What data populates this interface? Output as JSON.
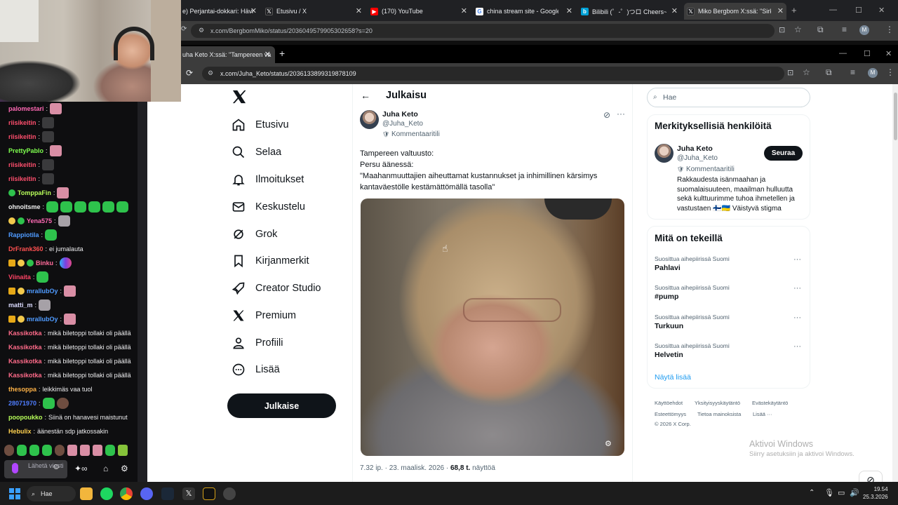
{
  "back_browser": {
    "tabs": [
      {
        "icon": "generic-page-icon",
        "label": "e) Perjantai-dokkari: Hävi"
      },
      {
        "icon": "x-logo-icon",
        "label": "Etusivu / X"
      },
      {
        "icon": "youtube-icon",
        "label": "(170) YouTube"
      },
      {
        "icon": "google-icon",
        "label": "china stream site - Google-h"
      },
      {
        "icon": "bilibili-icon",
        "label": "Bilibili (゜-゜)つロ Cheers~ -bili"
      },
      {
        "icon": "x-logo-icon",
        "label": "Miko Bergbom X:ssä: \"Sirkuk"
      }
    ],
    "url": "x.com/BergbomMiko/status/2036049579905302658?s=20"
  },
  "front_browser": {
    "tab_label": "uha Keto X:ssä: \"Tampereen va",
    "url": "x.com/Juha_Keto/status/2036133899319878109"
  },
  "x_nav": {
    "items": [
      {
        "icon": "home-icon",
        "label": "Etusivu"
      },
      {
        "icon": "search-icon",
        "label": "Selaa"
      },
      {
        "icon": "bell-icon",
        "label": "Ilmoitukset"
      },
      {
        "icon": "mail-icon",
        "label": "Keskustelu"
      },
      {
        "icon": "grok-icon",
        "label": "Grok"
      },
      {
        "icon": "bookmark-icon",
        "label": "Kirjanmerkit"
      },
      {
        "icon": "rocket-icon",
        "label": "Creator Studio"
      },
      {
        "icon": "x-logo-icon",
        "label": "Premium"
      },
      {
        "icon": "person-icon",
        "label": "Profiili"
      },
      {
        "icon": "more-circle-icon",
        "label": "Lisää"
      }
    ],
    "post_button": "Julkaise"
  },
  "post": {
    "header": "Julkaisu",
    "author_name": "Juha Keto",
    "author_handle": "@Juha_Keto",
    "author_badge": "Kommentaaritili",
    "text_lines": [
      "Tampereen valtuusto:",
      "Persu äänessä:",
      "\"Maahanmuuttajien aiheuttamat kustannukset ja inhimillinen kärsimys",
      "kantaväestölle kestämättömällä tasolla\""
    ],
    "meta_time": "7.32 ip. · 23. maalisk. 2026 ·",
    "meta_views_count": "68,8 t.",
    "meta_views_label": "näyttöä"
  },
  "right_column": {
    "search_placeholder": "Hae",
    "who_to_follow_title": "Merkityksellisiä henkilöitä",
    "follow": {
      "name": "Juha Keto",
      "handle": "@Juha_Keto",
      "badge": "Kommentaaritili",
      "button": "Seuraa",
      "bio": "Rakkaudesta isänmaahan ja suomalaisuuteen, maailman hulluutta sekä kulttuurimme tuhoa ihmetellen ja vastustaen 🇫🇮🇺🇦 Väistyvä stigma"
    },
    "trends_title": "Mitä on tekeillä",
    "trends": [
      {
        "context": "Suosittua aihepiirissä Suomi",
        "name": "Pahlavi"
      },
      {
        "context": "Suosittua aihepiirissä Suomi",
        "name": "#pump"
      },
      {
        "context": "Suosittua aihepiirissä Suomi",
        "name": "Turkuun"
      },
      {
        "context": "Suosittua aihepiirissä Suomi",
        "name": "Helvetin"
      }
    ],
    "show_more": "Näytä lisää",
    "footer": [
      "Käyttöehdot",
      "Yksityisyyskäytäntö",
      "Evästekäytäntö",
      "Esteettömyys",
      "Tietoa mainoksista",
      "Lisää ···",
      "© 2026 X Corp."
    ]
  },
  "activation": {
    "line1": "Aktivoi Windows",
    "line2": "Siirry asetuksiin ja aktivoi Windows."
  },
  "chat": {
    "messages": [
      {
        "user": "palomestari",
        "color": "#ff69b4",
        "text": ""
      },
      {
        "user": "riisikeitin",
        "color": "#ff4f6d",
        "text": ""
      },
      {
        "user": "riisikeitin",
        "color": "#ff4f6d",
        "text": ""
      },
      {
        "user": "PrettyPablo",
        "color": "#7fff4f",
        "text": ""
      },
      {
        "user": "riisikeitin",
        "color": "#ff4f6d",
        "text": ""
      },
      {
        "user": "riisikeitin",
        "color": "#ff4f6d",
        "text": ""
      },
      {
        "user": "TomppaFin",
        "color": "#b8ff5a",
        "text": ""
      },
      {
        "user": "ohnoitsme",
        "color": "#f0f0f0",
        "text": ""
      },
      {
        "user": "Yena575",
        "color": "#ff6bb5",
        "text": ""
      },
      {
        "user": "Rappiotila",
        "color": "#4f9bff",
        "text": ""
      },
      {
        "user": "DrFrank360",
        "color": "#ff5050",
        "text": "ei jumalauta"
      },
      {
        "user": "Binku",
        "color": "#ff6b9b",
        "text": ""
      },
      {
        "user": "Viinaita",
        "color": "#ff4466",
        "text": ""
      },
      {
        "user": "mrallubOy",
        "color": "#4f9bff",
        "text": ""
      },
      {
        "user": "matti_m",
        "color": "#dcdcff",
        "text": ""
      },
      {
        "user": "mrallubOy",
        "color": "#4f9bff",
        "text": ""
      },
      {
        "user": "Kassikotka",
        "color": "#ff6b8a",
        "text": "mikä biletoppi tollaki oli päällä"
      },
      {
        "user": "Kassikotka",
        "color": "#ff6b8a",
        "text": "mikä biletoppi tollaki oli päällä"
      },
      {
        "user": "Kassikotka",
        "color": "#ff6b8a",
        "text": "mikä biletoppi tollaki oli päällä"
      },
      {
        "user": "Kassikotka",
        "color": "#ff6b8a",
        "text": "mikä biletoppi tollaki oli päällä"
      },
      {
        "user": "thesoppa",
        "color": "#ffb347",
        "text": "leikkimäs vaa tuol"
      },
      {
        "user": "28071970",
        "color": "#4f7dff",
        "text": ""
      },
      {
        "user": "poopoukko",
        "color": "#b8ff5a",
        "text": "Siinä on hanavesi maistunut"
      },
      {
        "user": "Hebulix",
        "color": "#ffd24f",
        "text": "äänestän sdp jatkossakin"
      }
    ],
    "input_placeholder": "Lähetä viesti"
  },
  "taskbar": {
    "search_label": "Hae",
    "time": "19.54",
    "date": "25.3.2026"
  }
}
